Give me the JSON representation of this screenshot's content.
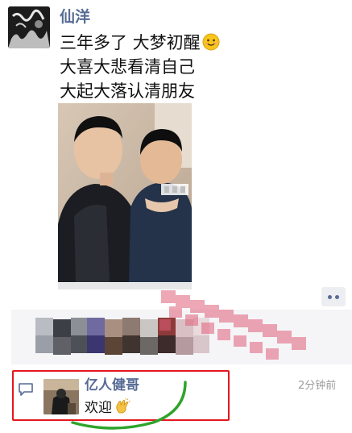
{
  "post": {
    "username": "仙洋",
    "lines": [
      "三年多了 大梦初醒",
      "大喜大悲看清自己",
      "大起大落认清朋友"
    ],
    "emoji": "smiling-face-emoji"
  },
  "more_button": {
    "icon": "more-dots-icon"
  },
  "comment": {
    "icon": "comment-icon",
    "author": "亿人健哥",
    "text": "欢迎",
    "emoji": "clapping-hands-emoji",
    "time": "2分钟前"
  },
  "colors": {
    "name_link": "#576b95",
    "annotation_box": "#e5161e",
    "annotation_scribble": "#2ea42a",
    "panel_bg": "#f5f5f7"
  }
}
